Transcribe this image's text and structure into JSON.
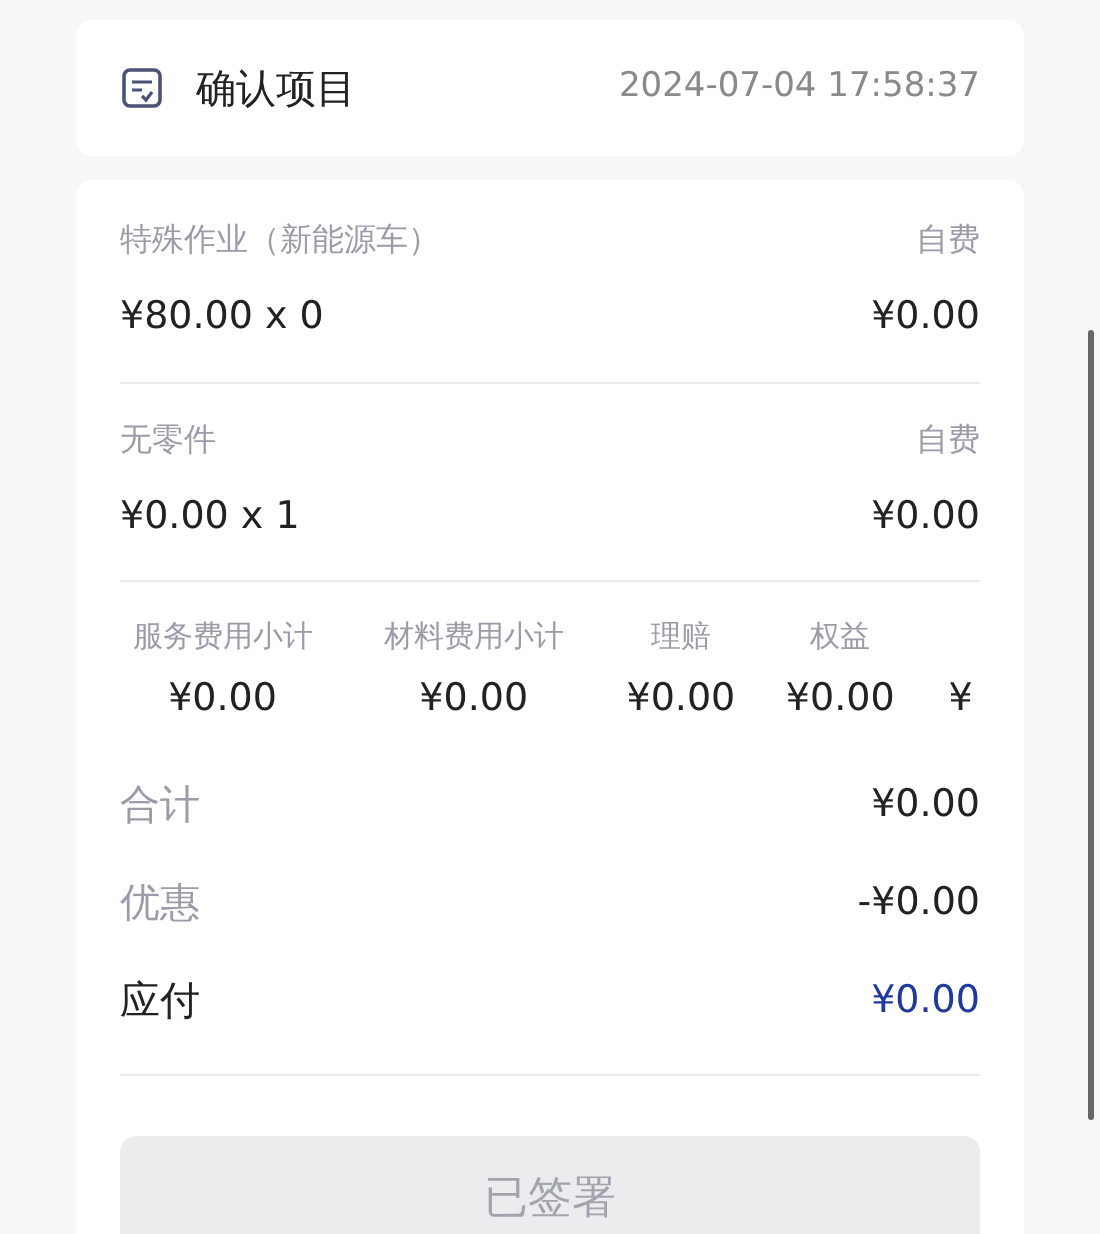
{
  "header": {
    "title": "确认项目",
    "datetime": "2024-07-04 17:58:37"
  },
  "items": [
    {
      "name": "特殊作业（新能源车）",
      "payment": "自费",
      "price": "¥80.00 x 0",
      "amount": "¥0.00"
    },
    {
      "name": "无零件",
      "payment": "自费",
      "price": "¥0.00 x 1",
      "amount": "¥0.00"
    }
  ],
  "summary": [
    {
      "label": "服务费用小计",
      "value": "¥0.00"
    },
    {
      "label": "材料费用小计",
      "value": "¥0.00"
    },
    {
      "label": "理赔",
      "value": "¥0.00"
    },
    {
      "label": "权益",
      "value": "¥0.00"
    },
    {
      "value": "¥"
    }
  ],
  "totals": [
    {
      "label": "合计",
      "value": "¥0.00",
      "highlight": false
    },
    {
      "label": "优惠",
      "value": "-¥0.00",
      "highlight": false
    },
    {
      "label": "应付",
      "value": "¥0.00",
      "highlight": true
    }
  ],
  "sign_button": {
    "label": "已签署",
    "disabled": true
  }
}
